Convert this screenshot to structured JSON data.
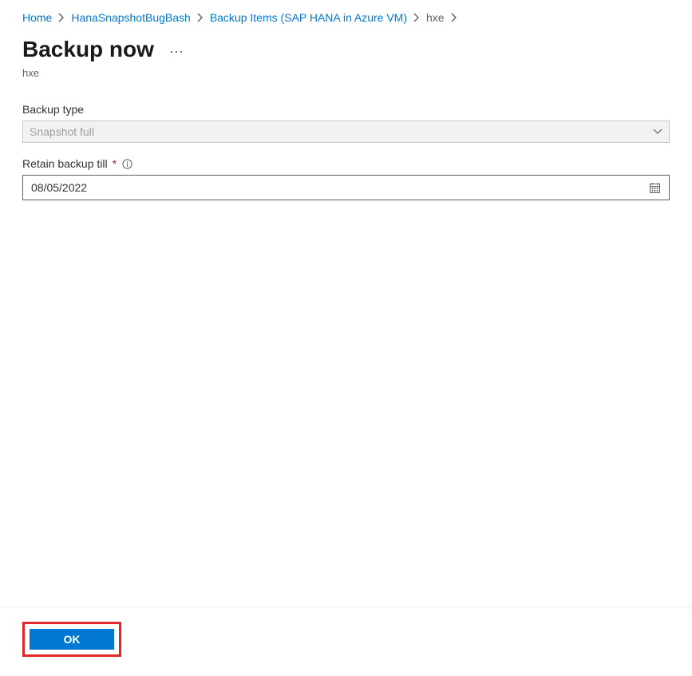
{
  "breadcrumb": {
    "items": [
      {
        "label": "Home"
      },
      {
        "label": "HanaSnapshotBugBash"
      },
      {
        "label": "Backup Items (SAP HANA in Azure VM)"
      },
      {
        "label": "hxe"
      }
    ]
  },
  "header": {
    "title": "Backup now",
    "subtitle": "hxe"
  },
  "form": {
    "backup_type": {
      "label": "Backup type",
      "value": "Snapshot full"
    },
    "retain_till": {
      "label": "Retain backup till",
      "value": "08/05/2022"
    }
  },
  "footer": {
    "ok_label": "OK"
  }
}
